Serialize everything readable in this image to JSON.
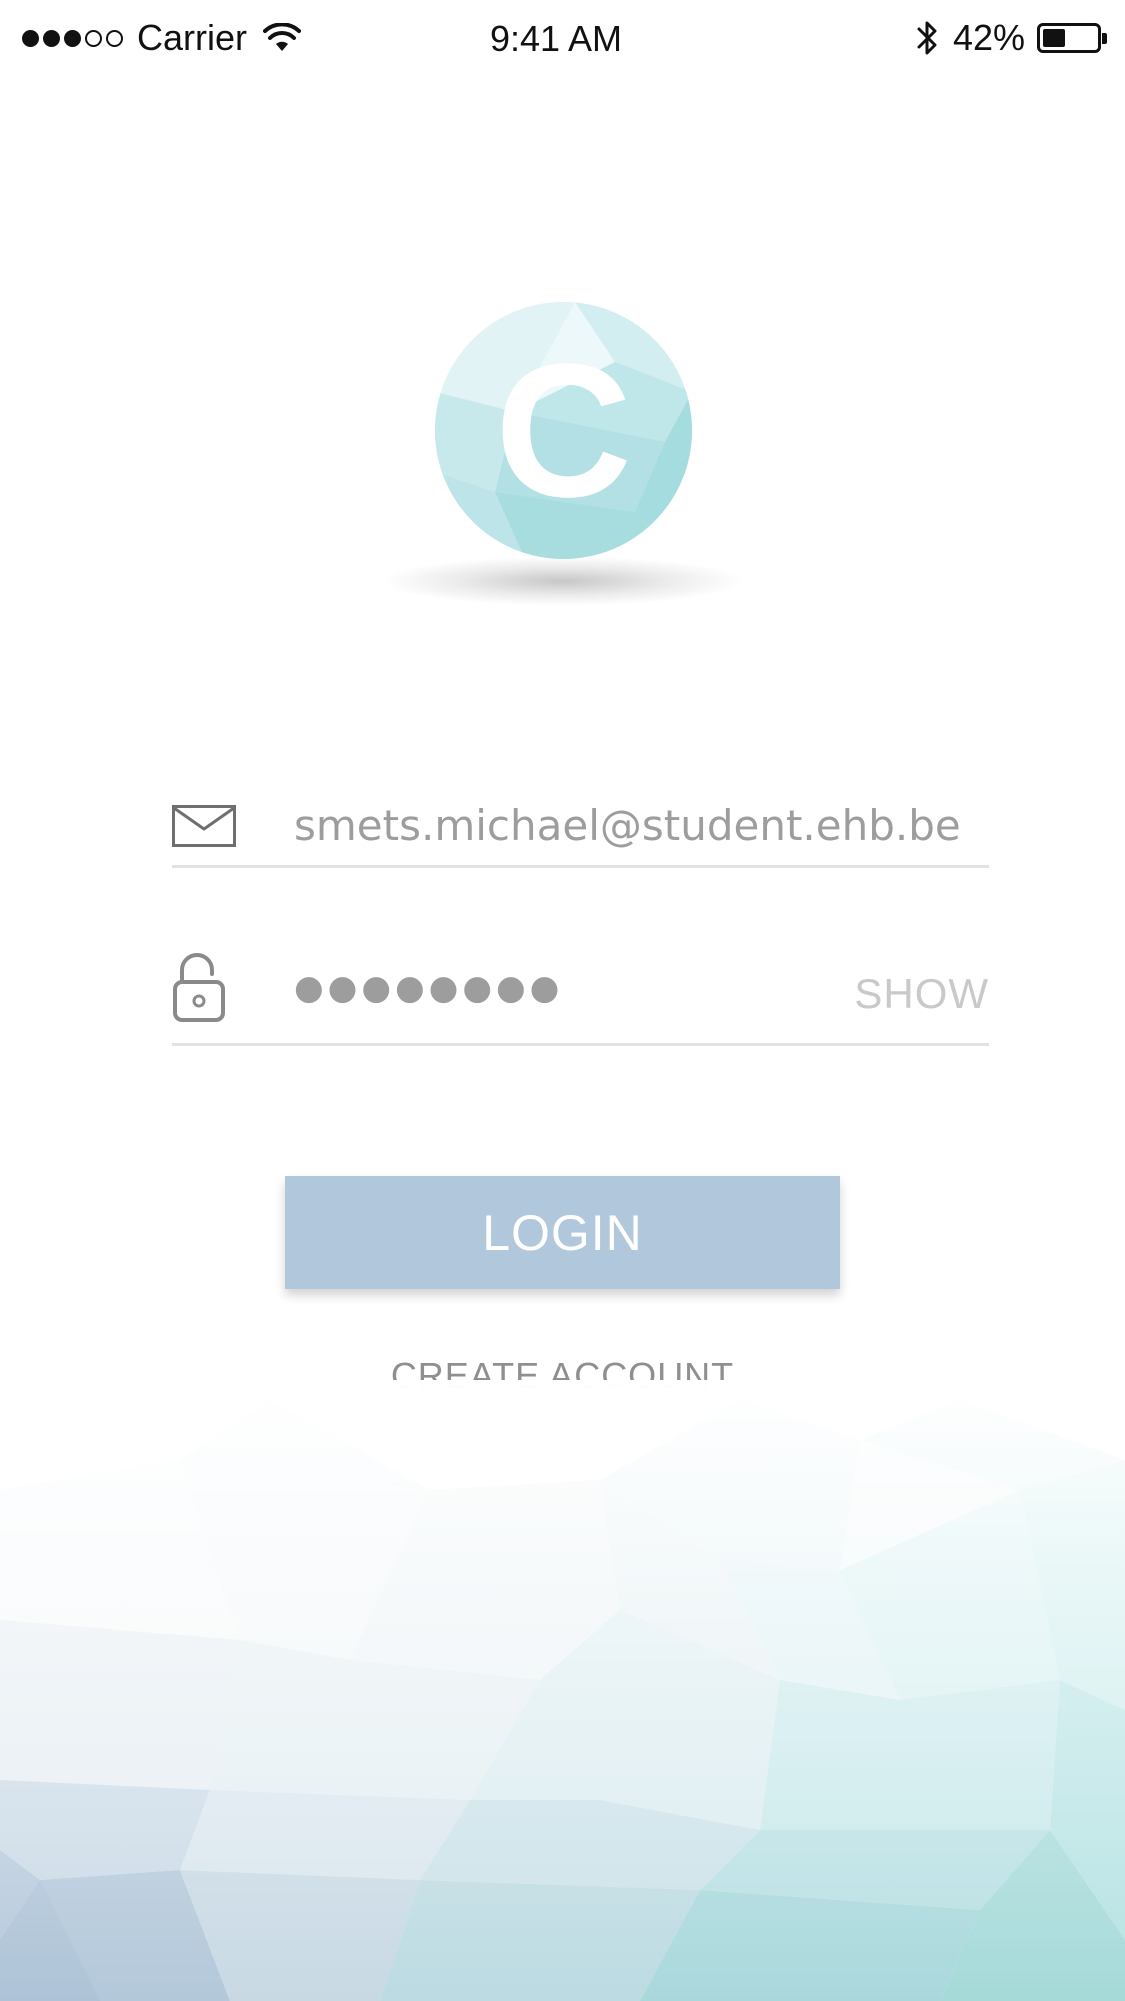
{
  "status_bar": {
    "carrier": "Carrier",
    "time": "9:41 AM",
    "battery_percent": "42%",
    "battery_level": 0.42,
    "signal_bars_filled": 3,
    "signal_bars_total": 5
  },
  "logo": {
    "letter": "C"
  },
  "email_field": {
    "value": "smets.michael@student.ehb.be",
    "icon": "envelope-icon"
  },
  "password_field": {
    "value": "●●●●●●●●",
    "icon": "lock-icon",
    "show_label": "SHOW"
  },
  "login_button": {
    "label": "LOGIN",
    "color": "#b1c8dc"
  },
  "create_account": {
    "label": "CREATE ACCOUNT"
  },
  "colors": {
    "accent_teal": "#9fd9d8",
    "accent_blue": "#b1c8dc",
    "placeholder_gray": "#9d9d9d"
  }
}
